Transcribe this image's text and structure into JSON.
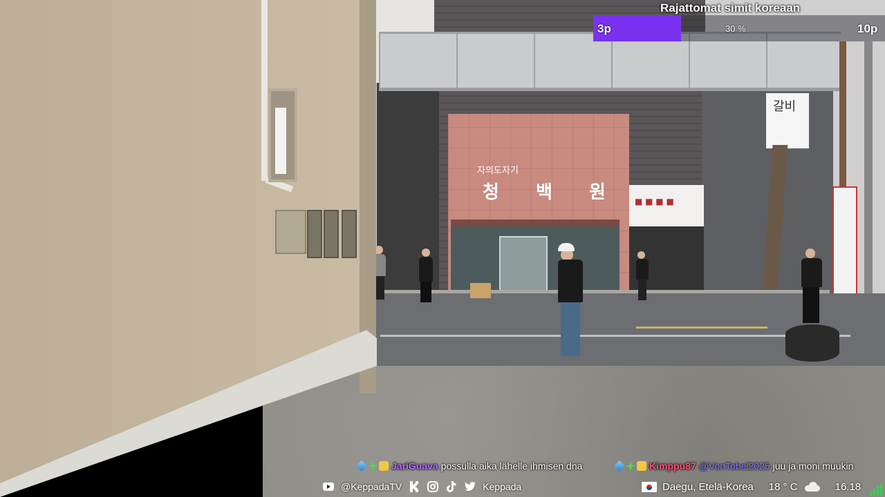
{
  "progress": {
    "title": "Rajattomat simit koreaan",
    "start_label": "3p",
    "percent_label": "30 %",
    "end_label": "10p",
    "value_fraction": 0.3,
    "fill_color": "#7a32f0"
  },
  "chat": [
    {
      "badges": [
        "cube-badge-icon",
        "sparkle-badge-icon",
        "smile-badge-icon"
      ],
      "user": "JariGuava",
      "user_color": "#b36cff",
      "message": "possulla aika lähelle ihmisen dna"
    },
    {
      "badges": [
        "cube-badge-icon",
        "sparkle-badge-icon",
        "smile-badge-icon"
      ],
      "user": "Kimppu87",
      "user_color": "#ff4f7a",
      "mention": "@VonTobel2025",
      "message": "juu ja moni muukin"
    }
  ],
  "socials": {
    "youtube_handle": "@KeppadaTV",
    "twitter_handle": "Keppada",
    "icons": [
      "youtube-icon",
      "kick-icon",
      "instagram-icon",
      "tiktok-icon",
      "twitter-icon"
    ]
  },
  "info": {
    "location": "Daegu, Etelä-Korea",
    "temperature": "18 ° C",
    "time": "16.18",
    "weather_icon": "cloud-icon",
    "flag_icon": "south-korea-flag-icon"
  },
  "scene": {
    "shop_sign": "청 백 원",
    "shop_sign_small": "자의도자기",
    "galbi_sign": "갈비"
  }
}
